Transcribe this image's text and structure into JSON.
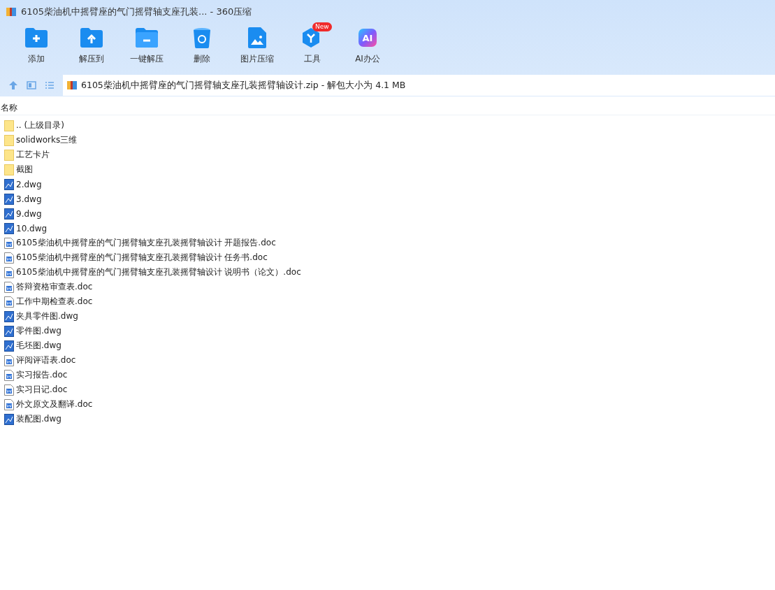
{
  "window": {
    "title": "6105柴油机中摇臂座的气门摇臂轴支座孔装... - 360压缩"
  },
  "toolbar": [
    {
      "kind": "add",
      "label": "添加"
    },
    {
      "kind": "extract",
      "label": "解压到"
    },
    {
      "kind": "oneclick",
      "label": "一键解压"
    },
    {
      "kind": "delete",
      "label": "删除"
    },
    {
      "kind": "image",
      "label": "图片压缩"
    },
    {
      "kind": "tools",
      "label": "工具",
      "badge": "New"
    },
    {
      "kind": "ai",
      "label": "AI办公",
      "icon_text": "AI"
    }
  ],
  "address": {
    "path": "6105柴油机中摇臂座的气门摇臂轴支座孔装摇臂轴设计.zip - 解包大小为 4.1 MB"
  },
  "table": {
    "columns": [
      "名称"
    ],
    "rows": [
      {
        "kind": "folder",
        "name": ".. (上级目录)"
      },
      {
        "kind": "folder",
        "name": "solidworks三维"
      },
      {
        "kind": "folder",
        "name": "工艺卡片"
      },
      {
        "kind": "folder",
        "name": "截图"
      },
      {
        "kind": "dwg",
        "name": "2.dwg"
      },
      {
        "kind": "dwg",
        "name": "3.dwg"
      },
      {
        "kind": "dwg",
        "name": "9.dwg"
      },
      {
        "kind": "dwg",
        "name": "10.dwg"
      },
      {
        "kind": "doc",
        "name": "6105柴油机中摇臂座的气门摇臂轴支座孔装摇臂轴设计 开题报告.doc"
      },
      {
        "kind": "doc",
        "name": "6105柴油机中摇臂座的气门摇臂轴支座孔装摇臂轴设计 任务书.doc"
      },
      {
        "kind": "doc",
        "name": "6105柴油机中摇臂座的气门摇臂轴支座孔装摇臂轴设计 说明书（论文）.doc"
      },
      {
        "kind": "doc",
        "name": "答辩资格审查表.doc"
      },
      {
        "kind": "doc",
        "name": "工作中期检查表.doc"
      },
      {
        "kind": "dwg",
        "name": "夹具零件图.dwg"
      },
      {
        "kind": "dwg",
        "name": "零件图.dwg"
      },
      {
        "kind": "dwg",
        "name": "毛坯图.dwg"
      },
      {
        "kind": "doc",
        "name": "评阅评语表.doc"
      },
      {
        "kind": "doc",
        "name": "实习报告.doc"
      },
      {
        "kind": "doc",
        "name": "实习日记.doc"
      },
      {
        "kind": "doc",
        "name": "外文原文及翻译.doc"
      },
      {
        "kind": "dwg",
        "name": "装配图.dwg"
      }
    ]
  }
}
